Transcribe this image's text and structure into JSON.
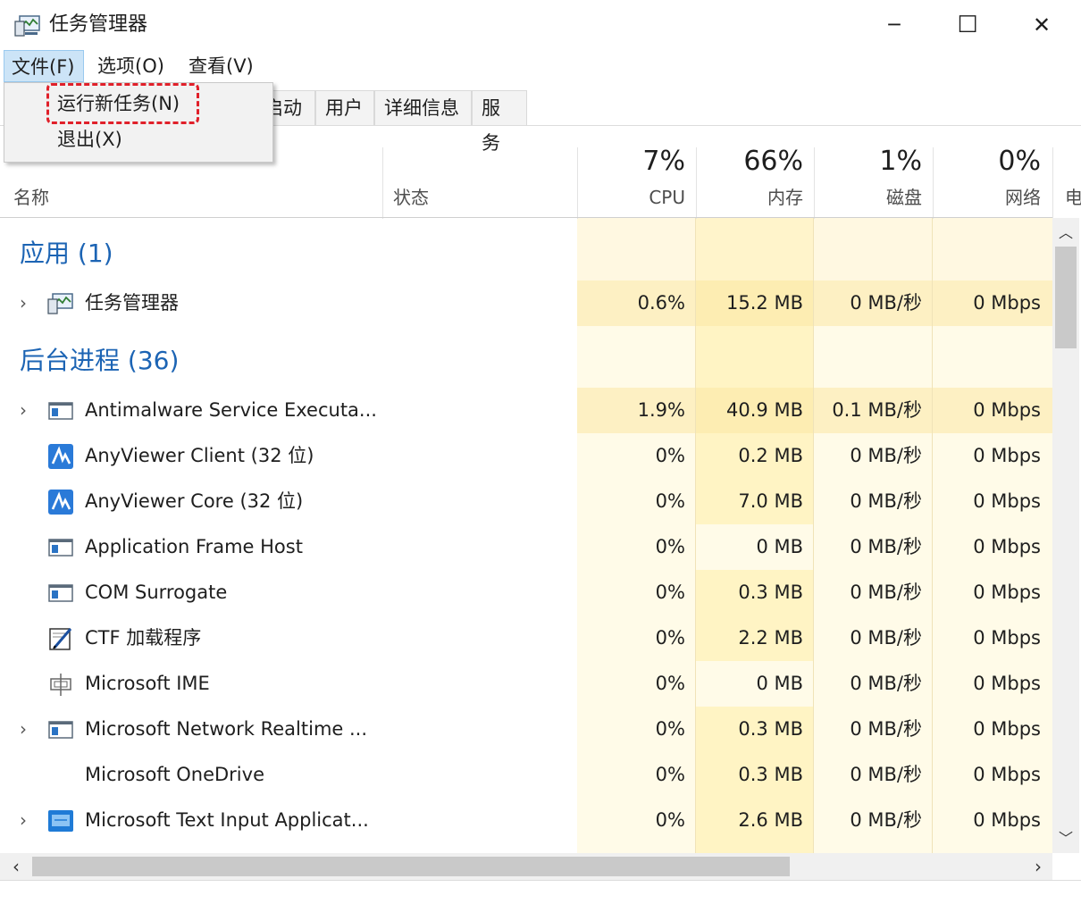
{
  "window": {
    "title": "任务管理器",
    "controls": {
      "minimize": "─",
      "maximize": "☐",
      "close": "✕"
    }
  },
  "menubar": {
    "file": "文件(F)",
    "options": "选项(O)",
    "view": "查看(V)"
  },
  "file_menu": {
    "items": [
      "运行新任务(N)",
      "退出(X)"
    ],
    "highlighted": "运行新任务(N)"
  },
  "tabs": [
    "启动",
    "用户",
    "详细信息",
    "服务"
  ],
  "columns": {
    "name": "名称",
    "status": "状态",
    "cpu": {
      "pct": "7%",
      "label": "CPU"
    },
    "memory": {
      "pct": "66%",
      "label": "内存"
    },
    "disk": {
      "pct": "1%",
      "label": "磁盘"
    },
    "network": {
      "pct": "0%",
      "label": "网络"
    },
    "power_partial": "电"
  },
  "groups": {
    "apps": {
      "title": "应用 (1)"
    },
    "background": {
      "title": "后台进程 (36)"
    }
  },
  "rows": [
    {
      "name": "任务管理器",
      "cpu": "0.6%",
      "mem": "15.2 MB",
      "disk": "0 MB/秒",
      "net": "0 Mbps",
      "icon": "task-manager-icon",
      "expandable": true
    },
    {
      "name": "Antimalware Service Executa...",
      "cpu": "1.9%",
      "mem": "40.9 MB",
      "disk": "0.1 MB/秒",
      "net": "0 Mbps",
      "icon": "window-app-icon",
      "expandable": true
    },
    {
      "name": "AnyViewer Client (32 位)",
      "cpu": "0%",
      "mem": "0.2 MB",
      "disk": "0 MB/秒",
      "net": "0 Mbps",
      "icon": "anyviewer-icon",
      "expandable": false
    },
    {
      "name": "AnyViewer Core (32 位)",
      "cpu": "0%",
      "mem": "7.0 MB",
      "disk": "0 MB/秒",
      "net": "0 Mbps",
      "icon": "anyviewer-icon",
      "expandable": false
    },
    {
      "name": "Application Frame Host",
      "cpu": "0%",
      "mem": "0 MB",
      "disk": "0 MB/秒",
      "net": "0 Mbps",
      "icon": "window-app-icon",
      "expandable": false
    },
    {
      "name": "COM Surrogate",
      "cpu": "0%",
      "mem": "0.3 MB",
      "disk": "0 MB/秒",
      "net": "0 Mbps",
      "icon": "window-app-icon",
      "expandable": false
    },
    {
      "name": "CTF 加载程序",
      "cpu": "0%",
      "mem": "2.2 MB",
      "disk": "0 MB/秒",
      "net": "0 Mbps",
      "icon": "pen-icon",
      "expandable": false
    },
    {
      "name": "Microsoft IME",
      "cpu": "0%",
      "mem": "0 MB",
      "disk": "0 MB/秒",
      "net": "0 Mbps",
      "icon": "ime-icon",
      "expandable": false
    },
    {
      "name": "Microsoft Network Realtime ...",
      "cpu": "0%",
      "mem": "0.3 MB",
      "disk": "0 MB/秒",
      "net": "0 Mbps",
      "icon": "window-app-icon",
      "expandable": true
    },
    {
      "name": "Microsoft OneDrive",
      "cpu": "0%",
      "mem": "0.3 MB",
      "disk": "0 MB/秒",
      "net": "0 Mbps",
      "icon": "none",
      "expandable": false
    },
    {
      "name": "Microsoft Text Input Applicat...",
      "cpu": "0%",
      "mem": "2.6 MB",
      "disk": "0 MB/秒",
      "net": "0 Mbps",
      "icon": "text-input-icon",
      "expandable": true
    }
  ],
  "colors": {
    "heat_light": "#fff4c4",
    "heat_medium": "#fbe7a4",
    "heat_pale": "#fffbe8",
    "group_title": "#1c64b4",
    "highlight_border": "#e0202a"
  }
}
